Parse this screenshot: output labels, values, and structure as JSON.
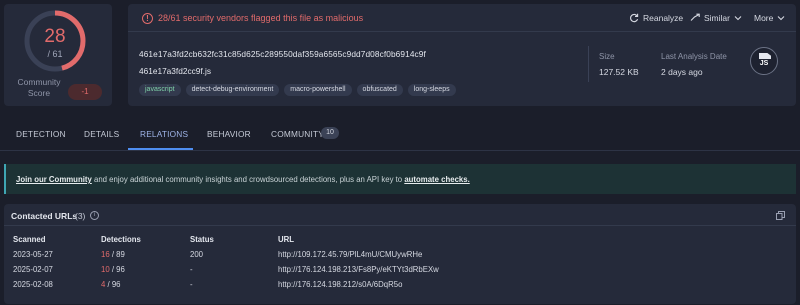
{
  "score": {
    "detected": "28",
    "total": "/ 61",
    "fraction": 0.459,
    "community_label": "Community Score",
    "community_value": "-1"
  },
  "alert": {
    "icon": "exclamation-circle-icon",
    "text": "28/61 security vendors flagged this file as malicious"
  },
  "actions": {
    "reanalyze": "Reanalyze",
    "similar": "Similar",
    "more": "More"
  },
  "file": {
    "hash": "461e17a3fd2cb632fc31c85d625c289550daf359a6565c9dd7d08cf0b6914c9f",
    "name": "461e17a3fd2cc9f.js",
    "tags": [
      "javascript",
      "detect-debug-environment",
      "macro-powershell",
      "obfuscated",
      "long-sleeps"
    ]
  },
  "meta": {
    "size_label": "Size",
    "size_value": "127.52 KB",
    "date_label": "Last Analysis Date",
    "date_value": "2 days ago",
    "filetype": "JS"
  },
  "tabs": {
    "detection": "DETECTION",
    "details": "DETAILS",
    "relations": "RELATIONS",
    "behavior": "BEHAVIOR",
    "community": "COMMUNITY",
    "community_count": "10",
    "active": "relations"
  },
  "banner": {
    "link1": "Join our Community",
    "text": " and enjoy additional community insights and crowdsourced detections, plus an API key to ",
    "link2": "automate checks."
  },
  "contacted_urls": {
    "title": "Contacted URLs",
    "count": "(3)",
    "columns": [
      "Scanned",
      "Detections",
      "Status",
      "URL"
    ],
    "rows": [
      {
        "scanned": "2023-05-27",
        "det": "16",
        "total": " / 89",
        "status": "200",
        "url": "http://109.172.45.79/PlL4mU/CMUywRHe"
      },
      {
        "scanned": "2025-02-07",
        "det": "10",
        "total": " / 96",
        "status": "-",
        "url": "http://176.124.198.213/Fs8Py/eKTYt3dRbEXw"
      },
      {
        "scanned": "2025-02-08",
        "det": "4",
        "total": " / 96",
        "status": "-",
        "url": "http://176.124.198.212/s0A/6DqR5o"
      }
    ]
  },
  "colors": {
    "malicious": "#e26b6b",
    "accent": "#4f8ef0",
    "background": "#1b1e2a",
    "panel": "#252a3a"
  }
}
